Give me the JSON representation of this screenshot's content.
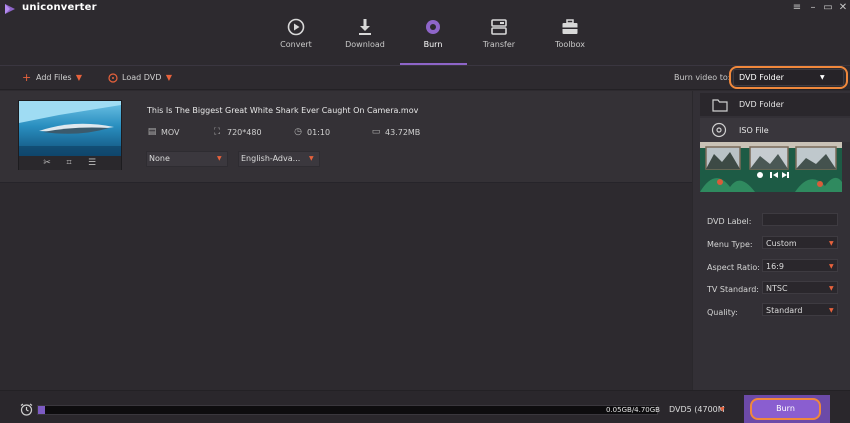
{
  "app": {
    "title": "uniconverter"
  },
  "window_controls": [
    "–",
    "▭",
    "✕"
  ],
  "nav": {
    "tabs": [
      {
        "label": "Convert",
        "icon": "play-circle-icon"
      },
      {
        "label": "Download",
        "icon": "download-arrow-icon"
      },
      {
        "label": "Burn",
        "icon": "disc-icon",
        "active": true
      },
      {
        "label": "Transfer",
        "icon": "transfer-icon"
      },
      {
        "label": "Toolbox",
        "icon": "toolbox-icon"
      }
    ]
  },
  "toolbar": {
    "add_files": "Add Files",
    "load_dvd": "Load DVD",
    "burn_to_label": "Burn video to:",
    "burn_to_value": "DVD Folder"
  },
  "file": {
    "name": "This Is The Biggest Great White Shark Ever Caught On Camera.mov",
    "format": "MOV",
    "resolution": "720*480",
    "duration": "01:10",
    "size": "43.72MB",
    "subtitle": "None",
    "audio": "English-Adva..."
  },
  "output_options": {
    "dvd_folder": "DVD Folder",
    "iso_file": "ISO File"
  },
  "settings": {
    "dvd_label": {
      "label": "DVD Label:",
      "value": ""
    },
    "menu_type": {
      "label": "Menu Type:",
      "value": "Custom"
    },
    "aspect_ratio": {
      "label": "Aspect Ratio:",
      "value": "16:9"
    },
    "tv_standard": {
      "label": "TV Standard:",
      "value": "NTSC"
    },
    "quality": {
      "label": "Quality:",
      "value": "Standard"
    }
  },
  "bottom": {
    "progress_fraction": 0.0116,
    "size_label": "0.05GB/4.70GB",
    "disc_type": "DVD5 (4700M",
    "burn_label": "Burn"
  },
  "colors": {
    "accent_purple": "#8a5ed0",
    "accent_orange": "#f0883c",
    "caret_red": "#e8623c"
  }
}
